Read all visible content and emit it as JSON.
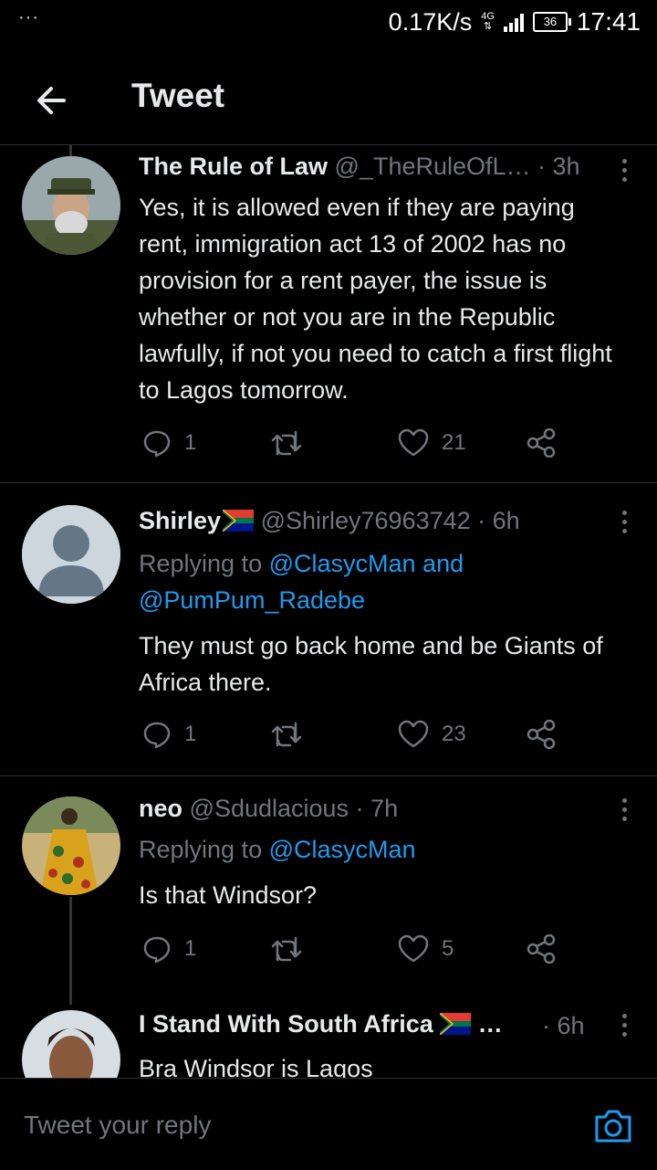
{
  "status": {
    "dots": "···",
    "net_speed": "0.17K/s",
    "net_type": "4G",
    "battery": "36",
    "time": "17:41"
  },
  "header": {
    "title": "Tweet"
  },
  "tweets": [
    {
      "name": "The Rule of Law",
      "handle": "@_TheRuleOfL…",
      "time": "· 3h",
      "text": "Yes, it is allowed even if they are paying rent, immigration act 13 of 2002 has no provision for a rent payer, the issue is whether or not you are in the Republic lawfully, if not you need to catch a first flight to Lagos tomorrow.",
      "replies": "1",
      "retweets": "",
      "likes": "21"
    },
    {
      "name": "Shirley",
      "handle": "@Shirley76963742",
      "time": "· 6h",
      "replying_prefix": "Replying to",
      "replying_to": "@ClasycMan and @PumPum_Radebe",
      "text": "They must go back home and be Giants of Africa there.",
      "replies": "1",
      "retweets": "",
      "likes": "23"
    },
    {
      "name": "neo",
      "handle": "@Sdudlacious",
      "time": "· 7h",
      "replying_prefix": "Replying to",
      "replying_to": "@ClasycMan",
      "text": "Is that Windsor?",
      "replies": "1",
      "retweets": "",
      "likes": "5"
    },
    {
      "name": "I Stand With South Africa",
      "handle": "…",
      "time": "· 6h",
      "text": "Bra Windsor is Lagos"
    }
  ],
  "reply_bar": {
    "placeholder": "Tweet your reply"
  },
  "colors": {
    "accent": "#1d9bf0",
    "muted": "#71767b",
    "divider": "#2f3336"
  },
  "icons": [
    "back-arrow-icon",
    "more-icon",
    "reply-icon",
    "retweet-icon",
    "like-icon",
    "share-icon",
    "camera-icon",
    "sa-flag-icon"
  ]
}
